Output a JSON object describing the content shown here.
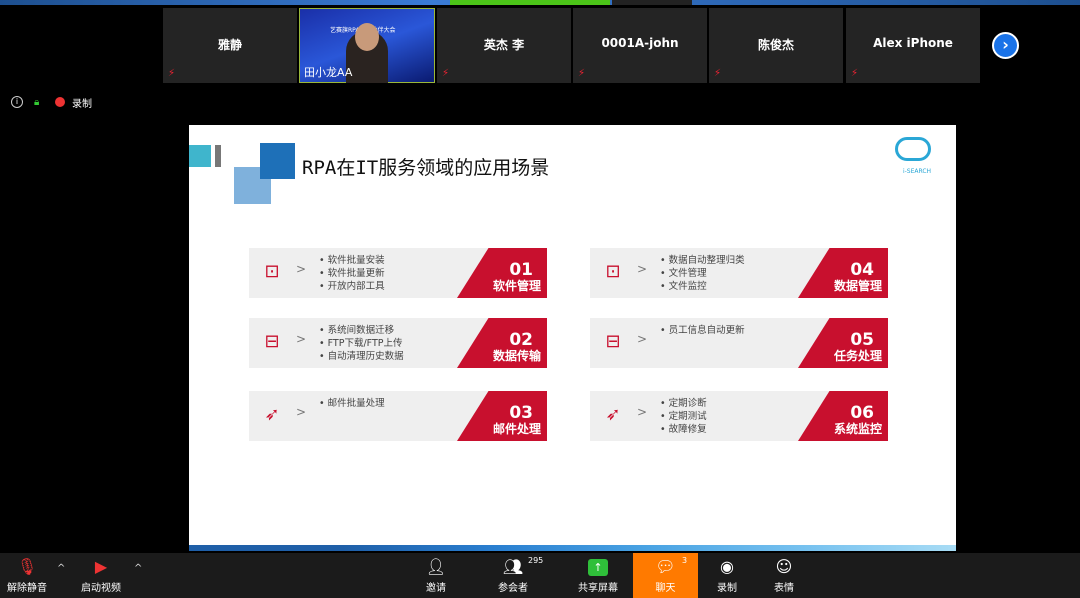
{
  "participants": [
    {
      "name": "雅静",
      "muted": true
    },
    {
      "name": "田小龙AA",
      "video": true,
      "banner": "艺赛旗RPA合作伙伴大会"
    },
    {
      "name": "英杰 李",
      "muted": true
    },
    {
      "name": "0001A-john",
      "muted": true
    },
    {
      "name": "陈俊杰",
      "muted": true
    },
    {
      "name": "Alex iPhone",
      "muted": true
    }
  ],
  "status": {
    "recording_label": "录制"
  },
  "slide": {
    "title": "RPA在IT服务领域的应用场景",
    "logo_text": "i-SEARCH",
    "cards": [
      {
        "num": "01",
        "label": "软件管理",
        "icon": "toolbox-icon",
        "items": [
          "软件批量安装",
          "软件批量更新",
          "开放内部工具"
        ]
      },
      {
        "num": "02",
        "label": "数据传输",
        "icon": "box-icon",
        "items": [
          "系统间数据迁移",
          "FTP下载/FTP上传",
          "自动清理历史数据"
        ]
      },
      {
        "num": "03",
        "label": "邮件处理",
        "icon": "paper-plane-icon",
        "items": [
          "邮件批量处理"
        ]
      },
      {
        "num": "04",
        "label": "数据管理",
        "icon": "toolbox-icon",
        "items": [
          "数据自动整理归类",
          "文件管理",
          "文件监控"
        ]
      },
      {
        "num": "05",
        "label": "任务处理",
        "icon": "box-icon",
        "items": [
          "员工信息自动更新"
        ]
      },
      {
        "num": "06",
        "label": "系统监控",
        "icon": "paper-plane-icon",
        "items": [
          "定期诊断",
          "定期测试",
          "故障修复"
        ]
      }
    ],
    "accent": "#c8102e"
  },
  "toolbar": {
    "unmute": "解除静音",
    "start_video": "启动视频",
    "invite": "邀请",
    "participants": "参会者",
    "participants_count": "295",
    "share": "共享屏幕",
    "chat": "聊天",
    "chat_count": "3",
    "record": "录制",
    "reactions": "表情",
    "chat_bg": "#ff7a00",
    "share_bg": "#2fbf3a"
  }
}
